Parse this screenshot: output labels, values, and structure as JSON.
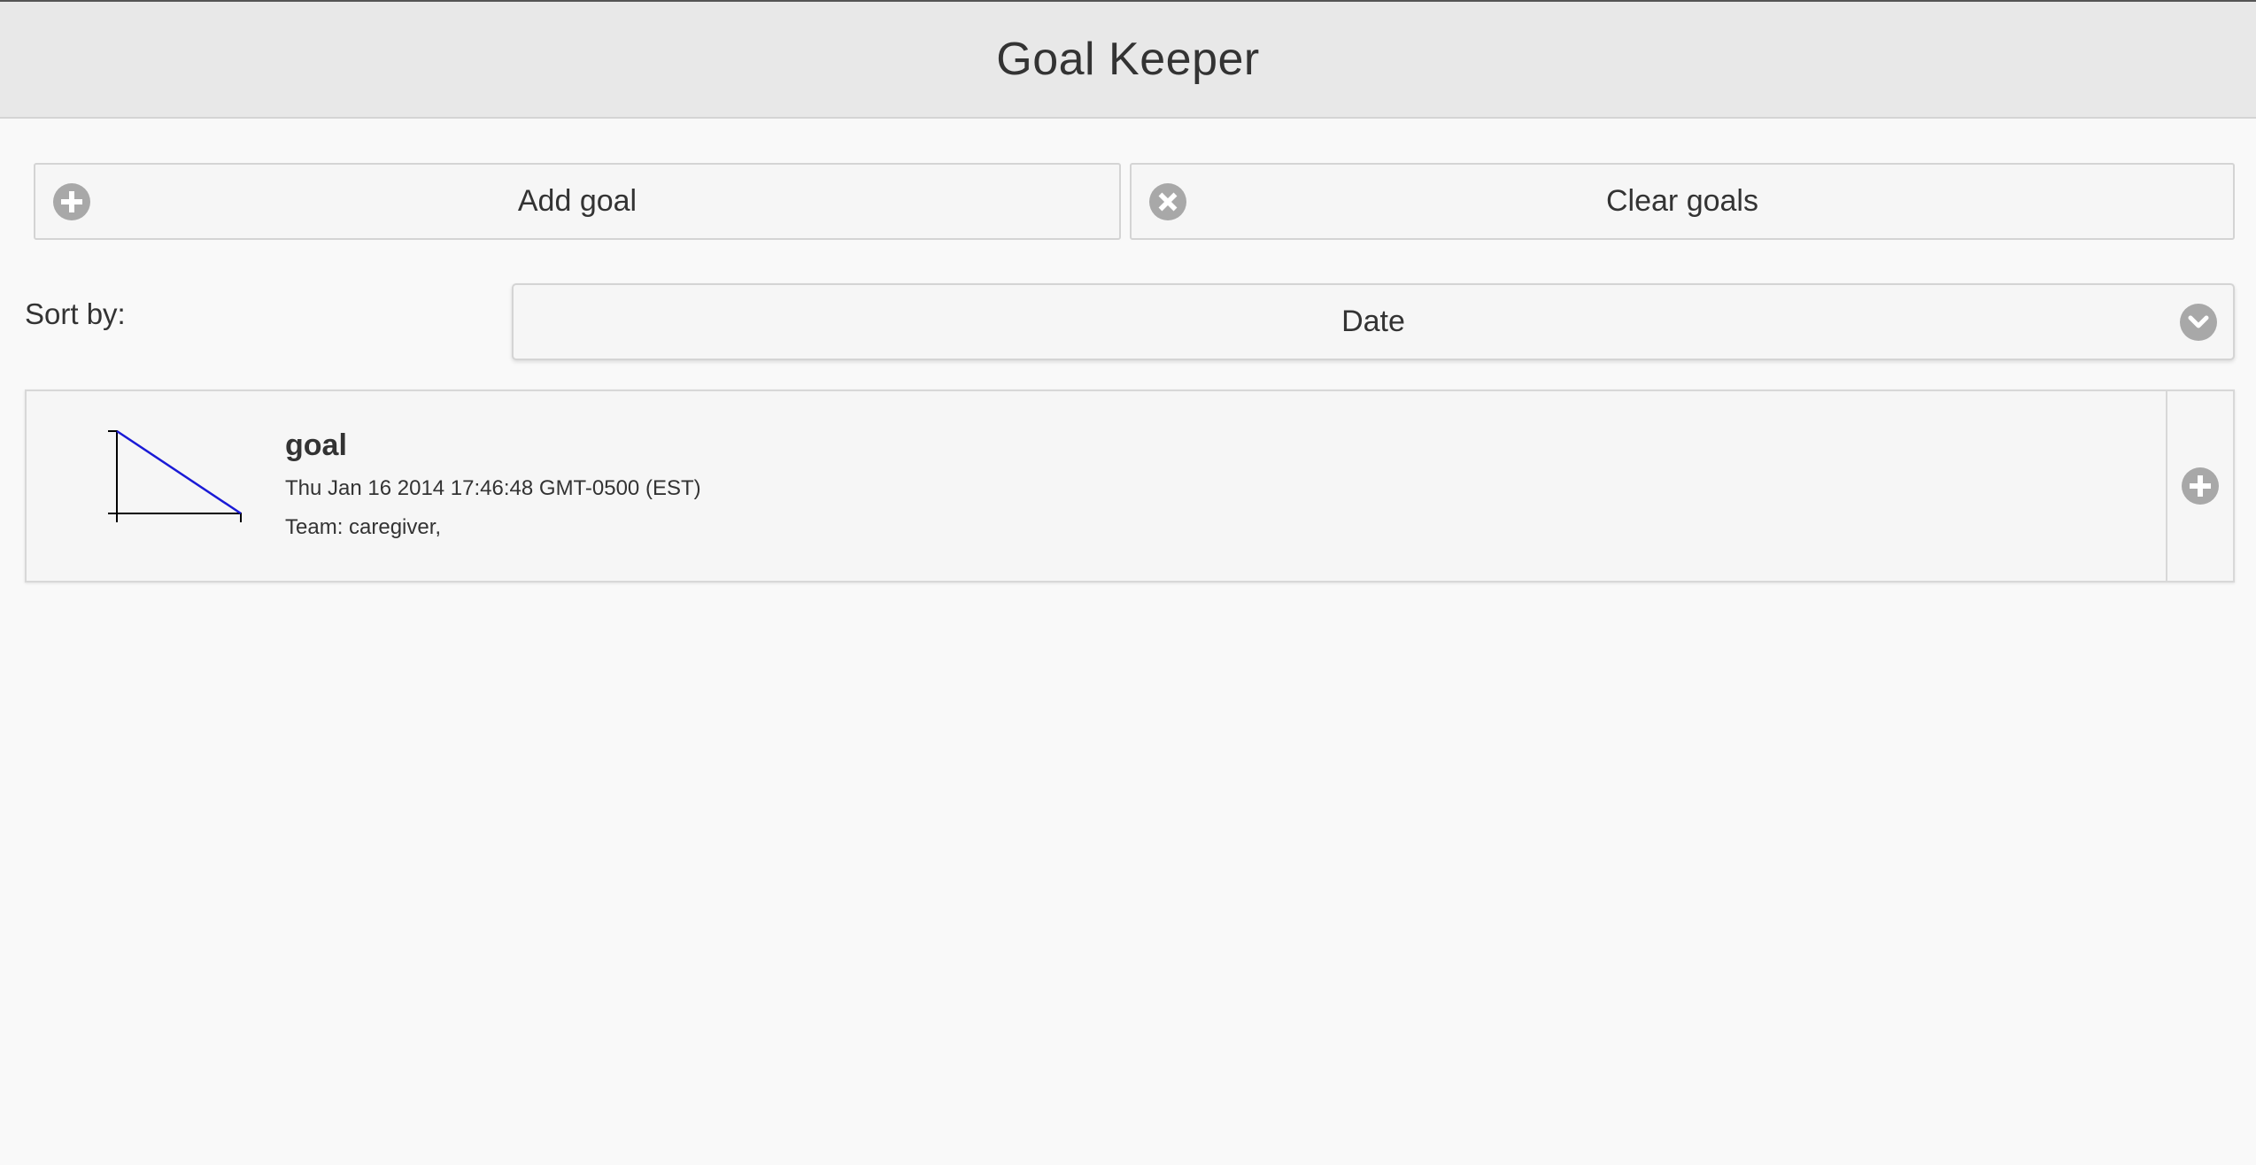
{
  "app": {
    "title": "Goal Keeper"
  },
  "toolbar": {
    "add_label": "Add goal",
    "add_icon": "plus-circle-icon",
    "clear_label": "Clear goals",
    "clear_icon": "x-circle-icon"
  },
  "sort": {
    "label": "Sort by:",
    "selected": "Date",
    "icon": "chevron-down-circle-icon"
  },
  "goals": [
    {
      "title": "goal",
      "date": "Thu Jan 16 2014 17:46:48 GMT-0500 (EST)",
      "team": "Team: caregiver,",
      "trend_color": "#1a1ad6",
      "add_icon": "plus-circle-icon"
    }
  ],
  "colors": {
    "header_bg": "#e8e8e8",
    "page_bg": "#f9f9f9",
    "icon_gray": "#a8a8a8",
    "text": "#333333"
  }
}
